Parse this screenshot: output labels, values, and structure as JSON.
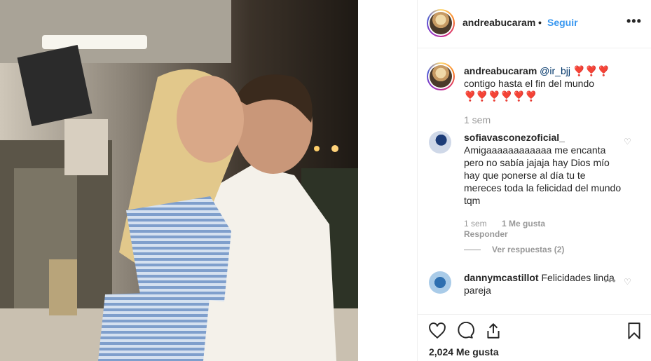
{
  "post": {
    "username": "andreabucaram",
    "separator": "•",
    "follow_label": "Seguir",
    "more_label": "•••"
  },
  "caption": {
    "username": "andreabucaram",
    "mention": "@ir_bjj",
    "hearts_inline": "❣️❣️❣️",
    "text": "contigo hasta el fin del mundo",
    "hearts_line": "❣️❣️❣️❣️❣️❣️",
    "time": "1 sem"
  },
  "comments": [
    {
      "username": "sofiavasconezoficial_",
      "text": "Amigaaaaaaaaaaaa me encanta pero no sabía jajaja hay Dios mío hay que ponerse al día tu te mereces toda la felicidad del mundo tqm",
      "time": "1 sem",
      "likes": "1 Me gusta",
      "reply_label": "Responder",
      "view_replies": "Ver respuestas (2)"
    },
    {
      "username": "dannymcastillot",
      "text": "Felicidades linda pareja",
      "more_label": "•••"
    }
  ],
  "actions": {
    "like_count": "2,024 Me gusta"
  },
  "icons": {
    "like": "heart-outline-icon",
    "comment": "comment-bubble-icon",
    "share": "share-upload-icon",
    "save": "bookmark-icon",
    "comment_like": "small-heart-icon"
  },
  "colors": {
    "link_blue": "#3897f0",
    "mention": "#003569",
    "heart_red": "#ed4956",
    "muted": "#999999"
  }
}
